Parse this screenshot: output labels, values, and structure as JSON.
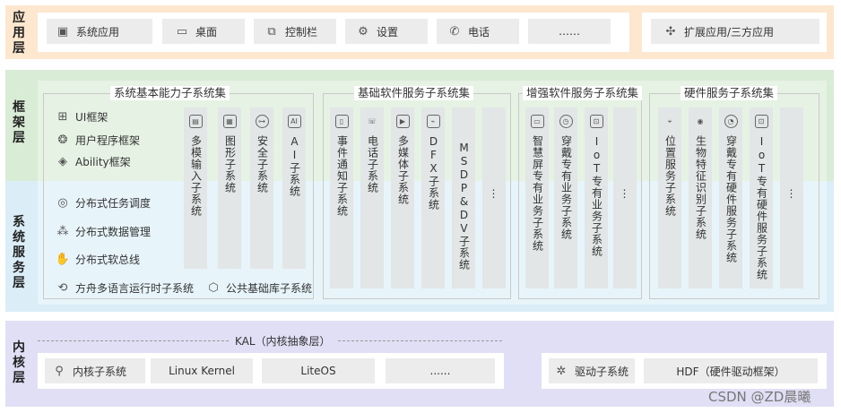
{
  "layers": {
    "app": {
      "label": "应用层"
    },
    "framework": {
      "label": "框架层"
    },
    "service": {
      "label": "系统服务层"
    },
    "kernel": {
      "label": "内核层"
    }
  },
  "app_layer": {
    "items": [
      {
        "icon": "app-icon",
        "label": "系统应用"
      },
      {
        "icon": "monitor-icon",
        "label": "桌面"
      },
      {
        "icon": "control-bar-icon",
        "label": "控制栏"
      },
      {
        "icon": "gear-icon",
        "label": "设置"
      },
      {
        "icon": "phone-icon",
        "label": "电话"
      },
      {
        "icon": "",
        "label": "……"
      }
    ],
    "extension": {
      "icon": "puzzle-icon",
      "label": "扩展应用/三方应用"
    }
  },
  "basic_capability": {
    "title": "系统基本能力子系统集",
    "framework_items": [
      {
        "icon": "ui-icon",
        "label": "UI框架"
      },
      {
        "icon": "user-framework-icon",
        "label": "用户程序框架"
      },
      {
        "icon": "layers-icon",
        "label": "Ability框架"
      }
    ],
    "service_items": [
      {
        "icon": "task-icon",
        "label": "分布式任务调度"
      },
      {
        "icon": "data-icon",
        "label": "分布式数据管理"
      },
      {
        "icon": "hand-icon",
        "label": "分布式软总线"
      }
    ],
    "bottom_items": [
      {
        "icon": "runtime-icon",
        "label": "方舟多语言运行时子系统"
      },
      {
        "icon": "library-icon",
        "label": "公共基础库子系统"
      }
    ],
    "columns": [
      {
        "icon": "input-icon",
        "label": "多模输入子系统"
      },
      {
        "icon": "graphics-icon",
        "label": "图形子系统"
      },
      {
        "icon": "security-icon",
        "label": "安全子系统"
      },
      {
        "icon": "ai-icon",
        "label": "AI子系统"
      }
    ]
  },
  "software_services": {
    "title": "基础软件服务子系统集",
    "columns": [
      {
        "icon": "notification-icon",
        "label": "事件通知子系统"
      },
      {
        "icon": "phone-service-icon",
        "label": "电话子系统"
      },
      {
        "icon": "media-icon",
        "label": "多媒体子系统"
      },
      {
        "icon": "dfx-icon",
        "label": "DFX子系统"
      },
      {
        "icon": "",
        "label": "MSDP&DV子系统"
      },
      {
        "icon": "",
        "label": "⋮"
      }
    ]
  },
  "enhanced_services": {
    "title": "增强软件服务子系统集",
    "columns": [
      {
        "icon": "screen-icon",
        "label": "智慧屏专有业务子系统"
      },
      {
        "icon": "watch-icon",
        "label": "穿戴专有业务子系统"
      },
      {
        "icon": "iot-icon",
        "label": "IoT专有业务子系统"
      },
      {
        "icon": "",
        "label": "⋮"
      }
    ]
  },
  "hardware_services": {
    "title": "硬件服务子系统集",
    "columns": [
      {
        "icon": "location-icon",
        "label": "位置服务子系统"
      },
      {
        "icon": "eye-icon",
        "label": "生物特征识别子系统"
      },
      {
        "icon": "wearable-icon",
        "label": "穿戴专有硬件服务子系统"
      },
      {
        "icon": "iot-hw-icon",
        "label": "IoT专有硬件服务子系统"
      },
      {
        "icon": "",
        "label": "⋮"
      }
    ]
  },
  "kernel_layer": {
    "kal_label": "KAL（内核抽象层）",
    "items": [
      {
        "icon": "kernel-icon",
        "label": "内核子系统"
      },
      {
        "icon": "",
        "label": "Linux Kernel"
      },
      {
        "icon": "",
        "label": "LiteOS"
      },
      {
        "icon": "",
        "label": "......"
      }
    ],
    "driver": {
      "icon": "driver-icon",
      "label": "驱动子系统"
    },
    "hdf": {
      "label": "HDF（硬件驱动框架）"
    }
  },
  "watermark": "CSDN @ZD晨曦",
  "colors": {
    "app_bg": "#fde8cf",
    "framework_bg": "#d9edd6",
    "service_bg": "#dbeef7",
    "kernel_bg": "#e0dff5",
    "box": "#ececec",
    "column": "#e3e6e6"
  }
}
